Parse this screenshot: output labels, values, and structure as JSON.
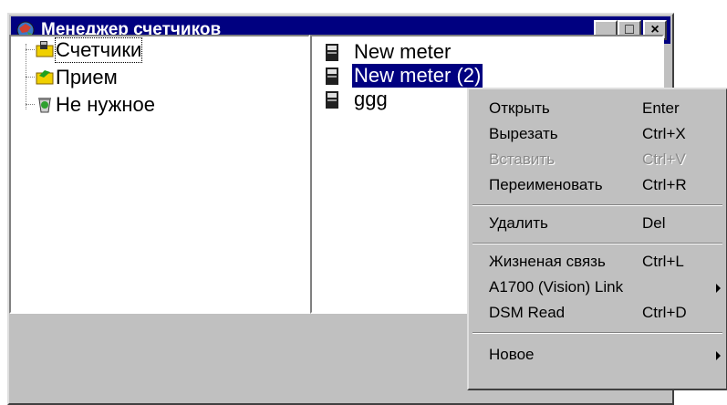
{
  "window": {
    "title": "Менеджер счетчиков",
    "minimize_glyph": "_",
    "maximize_glyph": "□",
    "close_glyph": "×"
  },
  "tree": {
    "items": [
      {
        "label": "Счетчики",
        "icon": "meters-folder-icon"
      },
      {
        "label": "Прием",
        "icon": "receive-folder-icon"
      },
      {
        "label": "Не нужное",
        "icon": "recycle-bin-icon"
      }
    ]
  },
  "list": {
    "items": [
      {
        "label": "New meter",
        "selected": false
      },
      {
        "label": "New meter (2)",
        "selected": true
      },
      {
        "label": "ggg",
        "selected": false
      }
    ]
  },
  "context_menu": {
    "open": {
      "label": "Открыть",
      "shortcut": "Enter"
    },
    "cut": {
      "label": "Вырезать",
      "shortcut": "Ctrl+X"
    },
    "paste": {
      "label": "Вставить",
      "shortcut": "Ctrl+V",
      "disabled": true
    },
    "rename": {
      "label": "Переименовать",
      "shortcut": "Ctrl+R"
    },
    "delete": {
      "label": "Удалить",
      "shortcut": "Del"
    },
    "live_link": {
      "label": "Жизненая связь",
      "shortcut": "Ctrl+L"
    },
    "a1700_link": {
      "label": "A1700 (Vision) Link",
      "submenu": true
    },
    "dsm_read": {
      "label": "DSM Read",
      "shortcut": "Ctrl+D"
    },
    "new": {
      "label": "Новое",
      "submenu": true
    }
  },
  "colors": {
    "title_bar": "#000080",
    "face": "#c0c0c0",
    "selection": "#000080"
  }
}
